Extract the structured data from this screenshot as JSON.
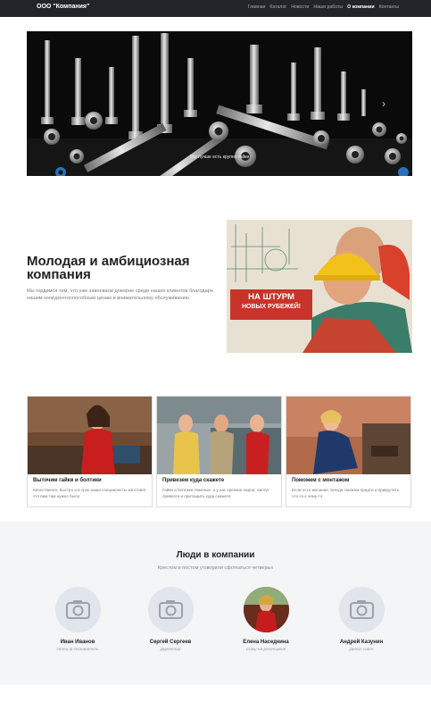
{
  "nav": {
    "brand": "ООО \"Компания\"",
    "links": [
      {
        "label": "Главная",
        "active": false
      },
      {
        "label": "Каталог",
        "active": false
      },
      {
        "label": "Новости",
        "active": false
      },
      {
        "label": "Наши работы",
        "active": false
      },
      {
        "label": "О компании",
        "active": true
      },
      {
        "label": "Контакты",
        "active": false
      }
    ]
  },
  "carousel": {
    "caption": "Мы лучше есть крупно гайки",
    "next_icon": "chevron-right-icon"
  },
  "about": {
    "title": "Молодая и амбициозная компания",
    "text": "Мы гордимся тем, что уже завоевали доверие среди наших клиентов благодаря нашим конкурентоспособным ценам и внимательному обслуживанию.",
    "poster_text_line1": "НА ШТУРМ",
    "poster_text_line2": "НОВЫХ РУБЕЖЕЙ!"
  },
  "cards": [
    {
      "title": "Выточим гайки и болтики",
      "text": "Качественно, быстро и в срок наши специалисты изготовят что вам там нужно было"
    },
    {
      "title": "Привезем куда скажете",
      "text": "Гайки и болтики тяжелые, а у нас крепкие парни, смогут привезти и притащить куда скажете"
    },
    {
      "title": "Поможем с монтажом",
      "text": "Если есть желание, всегда сможем придти и прикрутить что-то к чему-то"
    }
  ],
  "people": {
    "title": "Люди в компании",
    "subtitle": "Крестом и постом уговорили сфоткаться четверых",
    "members": [
      {
        "name": "Иван Иванов",
        "role": "Отец & Основатель",
        "photo": "camera-placeholder-icon"
      },
      {
        "name": "Сергей Сергеев",
        "role": "Директор",
        "photo": "camera-placeholder-icon"
      },
      {
        "name": "Елена Наседкина",
        "role": "Сижу на ресепшене",
        "photo": "portrait"
      },
      {
        "name": "Андрей Казунин",
        "role": "Делал сайт",
        "photo": "camera-placeholder-icon"
      }
    ]
  }
}
